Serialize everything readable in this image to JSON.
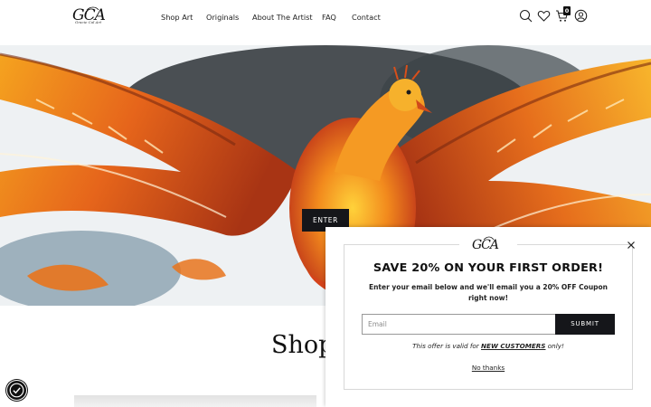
{
  "header": {
    "logo_text": "GCA",
    "logo_subtitle": "Gracie Cal Art",
    "nav": [
      {
        "label": "Shop Art"
      },
      {
        "label": "Originals"
      },
      {
        "label": "About The Artist"
      },
      {
        "label": "FAQ"
      },
      {
        "label": "Contact"
      }
    ],
    "icons": [
      "search-icon",
      "wishlist-heart-icon",
      "cart-icon",
      "account-icon"
    ],
    "cart_count": "0"
  },
  "hero": {
    "image": "phoenix-painting",
    "button_label": "ENTER"
  },
  "section": {
    "heading": "Shop"
  },
  "popup": {
    "logo_text": "GCA",
    "title": "SAVE 20% ON YOUR FIRST ORDER!",
    "description": "Enter your email below and we'll email you a 20% OFF Coupon right now!",
    "email_placeholder": "Email",
    "submit_label": "SUBMIT",
    "offer_prefix": "This offer is valid for ",
    "offer_highlight": "NEW CUSTOMERS",
    "offer_suffix": " only!",
    "dismiss_label": "No thanks"
  },
  "accessibility": {
    "icon": "accessibility-icon"
  },
  "colors": {
    "button": "#15161a",
    "background": "#ffffff",
    "phoenix_orange": "#e8741c"
  }
}
